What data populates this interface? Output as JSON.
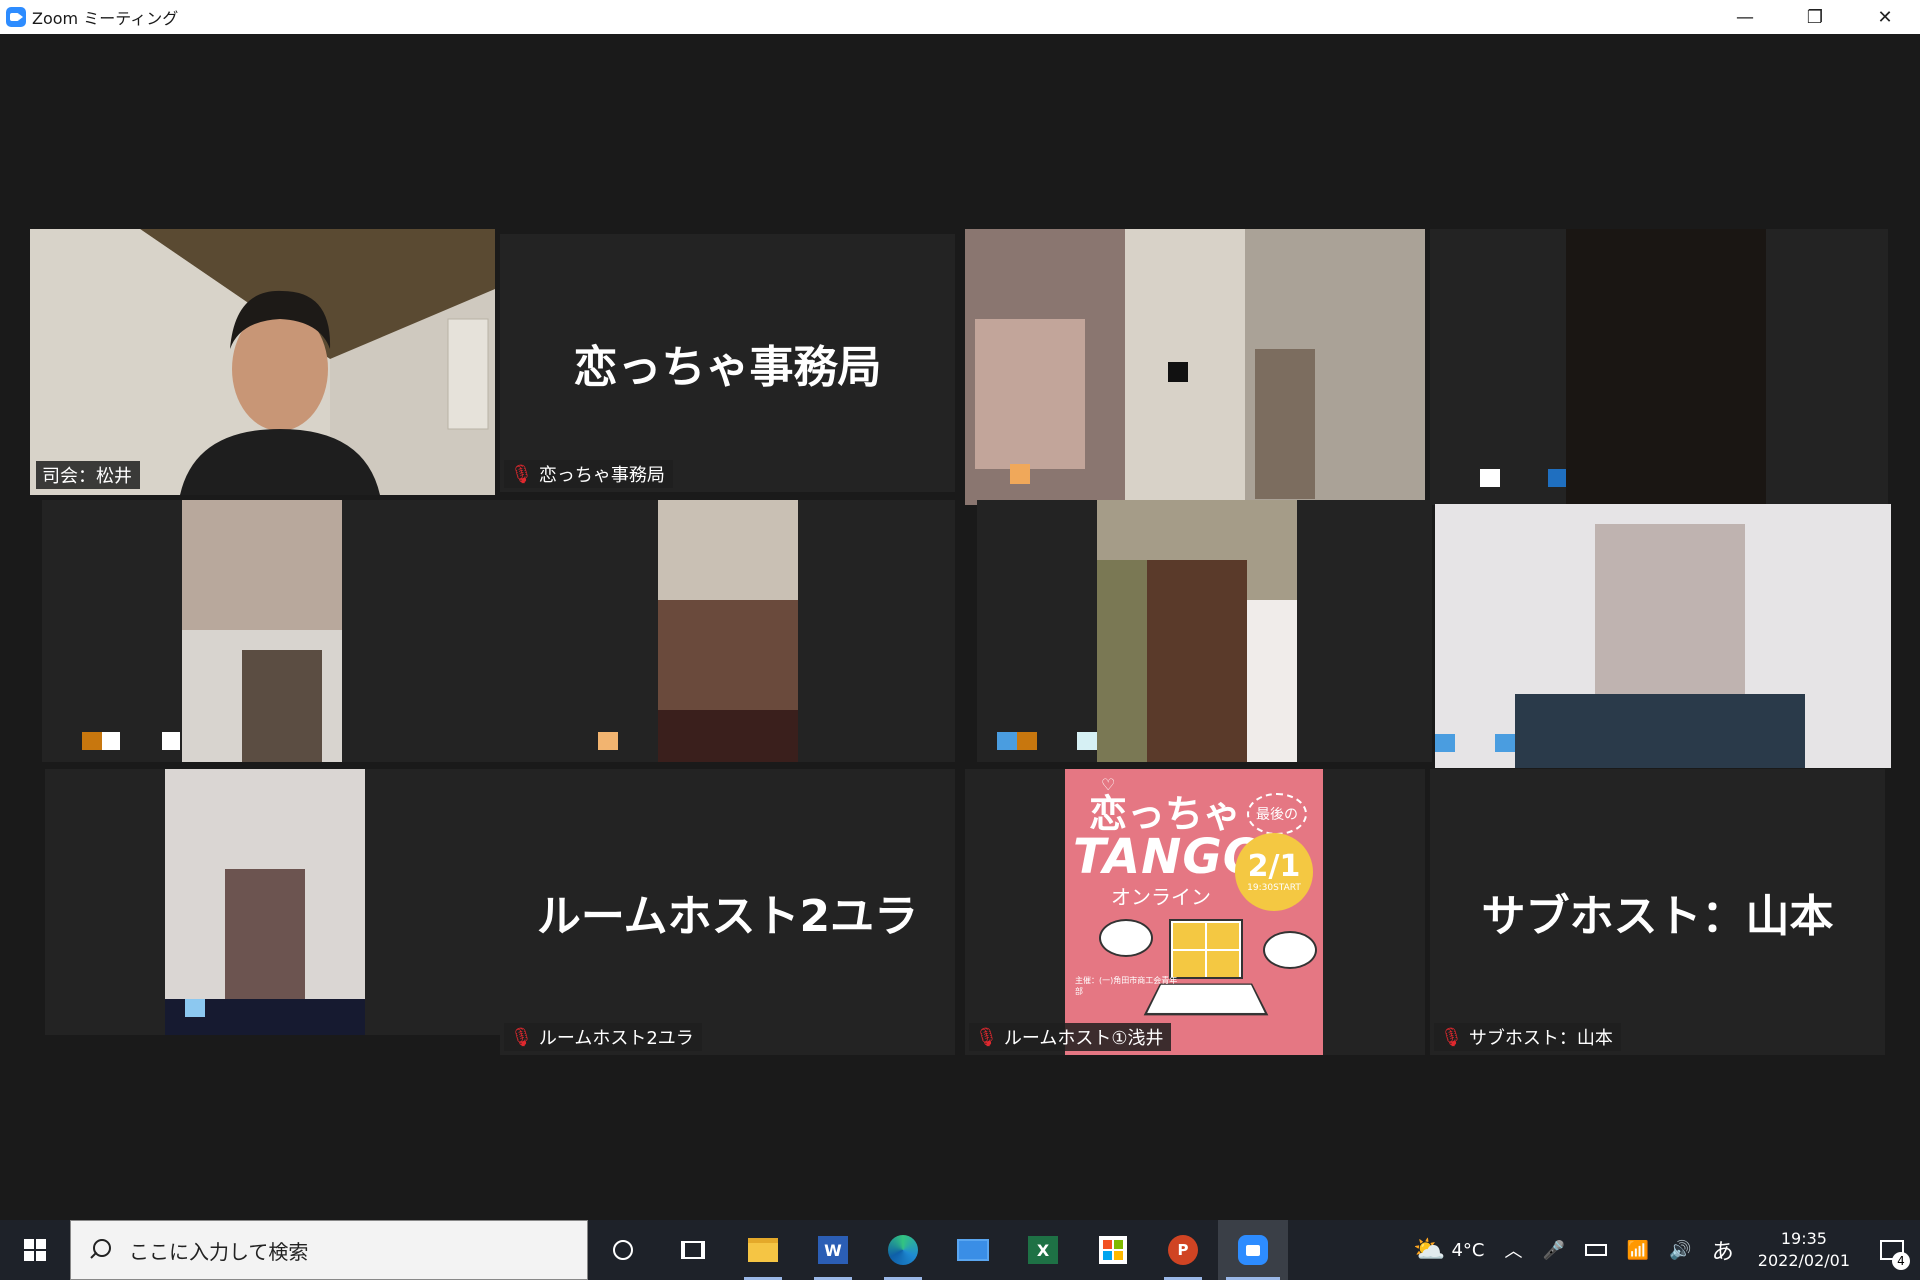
{
  "window": {
    "title": "Zoom ミーティング",
    "minimize_glyph": "—",
    "restore_glyph": "❐",
    "close_glyph": "✕"
  },
  "tiles": {
    "host_mc": {
      "label": "司会：松井"
    },
    "office": {
      "big_name": "恋っちゃ事務局",
      "label": "恋っちゃ事務局"
    },
    "room_host_2": {
      "big_name": "ルームホスト2ユラ",
      "label": "ルームホスト2ユラ"
    },
    "room_host_1": {
      "label": "ルームホスト①浅井",
      "poster": {
        "title": "恋っちゃ",
        "subtitle": "TANGO",
        "last": "最後の",
        "online": "オンライン",
        "date": "2/1",
        "start": "19:30START",
        "organizer": "主催：(一)角田市商工会青年部"
      }
    },
    "sub_host": {
      "big_name": "サブホスト：山本",
      "label": "サブホスト：山本"
    }
  },
  "taskbar": {
    "search_placeholder": "ここに入力して検索",
    "weather_temp": "4°C",
    "ime": "あ",
    "time": "19:35",
    "date": "2022/02/01",
    "notification_count": "4"
  },
  "colors": {
    "active_speaker_border": "#c6e86a",
    "mute_red": "#e0282e",
    "poster_pink": "#e57783",
    "zoom_blue": "#2d8cff"
  }
}
